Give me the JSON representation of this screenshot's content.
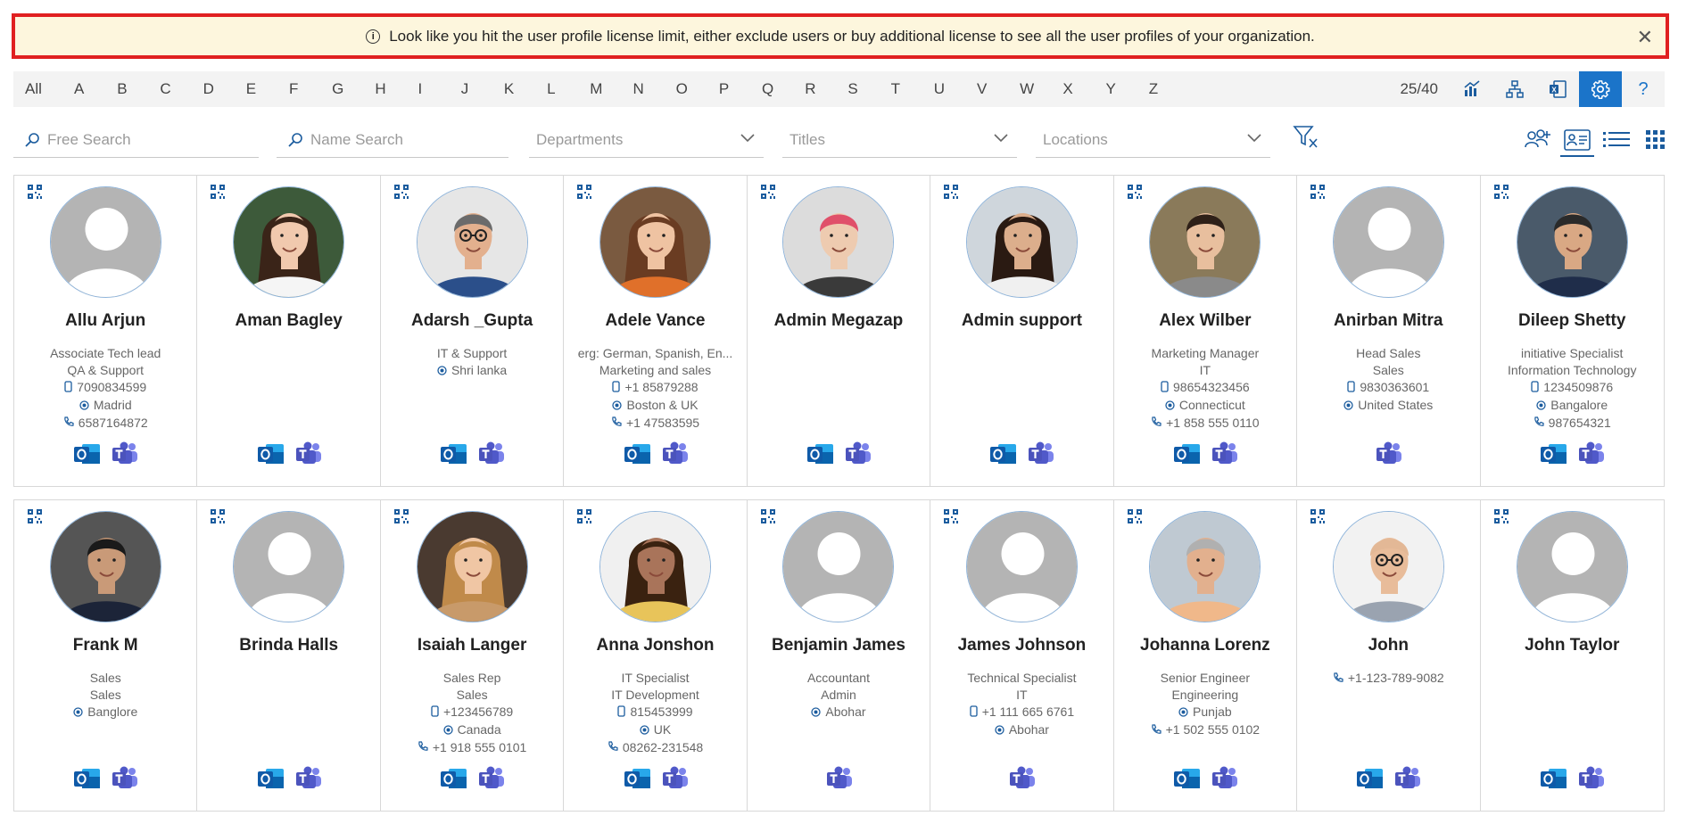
{
  "banner": {
    "message": "Look like you hit the user profile license limit, either exclude users or buy additional license to see all the user profiles of your organization.",
    "close_label": "✕"
  },
  "alphabet": [
    "All",
    "A",
    "B",
    "C",
    "D",
    "E",
    "F",
    "G",
    "H",
    "I",
    "J",
    "K",
    "L",
    "M",
    "N",
    "O",
    "P",
    "Q",
    "R",
    "S",
    "T",
    "U",
    "V",
    "W",
    "X",
    "Y",
    "Z"
  ],
  "toolbar": {
    "count": "25/40",
    "help_label": "?"
  },
  "filters": {
    "free_search": "Free Search",
    "name_search": "Name Search",
    "departments": "Departments",
    "titles": "Titles",
    "locations": "Locations"
  },
  "colors": {
    "accent": "#1b74c9",
    "banner_border": "#e02020",
    "banner_bg": "#fdf6dd"
  },
  "rows": [
    [
      {
        "name": "Allu Arjun",
        "photo": "placeholder",
        "lines": [
          {
            "t": "Associate Tech lead"
          },
          {
            "t": "QA & Support"
          },
          {
            "i": "mobile-icon",
            "t": "7090834599"
          },
          {
            "i": "location-icon",
            "t": "Madrid"
          },
          {
            "i": "phone-icon",
            "t": "6587164872"
          }
        ],
        "apps": [
          "outlook",
          "teams"
        ]
      },
      {
        "name": "Aman Bagley",
        "photo": "woman-dark-hair",
        "lines": [],
        "apps": [
          "outlook",
          "teams"
        ]
      },
      {
        "name": "Adarsh _Gupta",
        "photo": "man-glasses",
        "lines": [
          {
            "t": "IT & Support"
          },
          {
            "i": "location-icon",
            "t": "Shri lanka"
          }
        ],
        "apps": [
          "outlook",
          "teams"
        ]
      },
      {
        "name": "Adele Vance",
        "photo": "woman-curly",
        "lines": [
          {
            "t": "erg: German, Spanish, En..."
          },
          {
            "t": "Marketing and sales"
          },
          {
            "i": "mobile-icon",
            "t": "+1 85879288"
          },
          {
            "i": "location-icon",
            "t": "Boston & UK"
          },
          {
            "i": "phone-icon",
            "t": "+1 47583595"
          }
        ],
        "apps": [
          "outlook",
          "teams"
        ]
      },
      {
        "name": "Admin Megazap",
        "photo": "man-red-hair",
        "lines": [],
        "apps": [
          "outlook",
          "teams"
        ]
      },
      {
        "name": "Admin support",
        "photo": "woman-smile",
        "lines": [],
        "apps": [
          "outlook",
          "teams"
        ]
      },
      {
        "name": "Alex Wilber",
        "photo": "man-tie",
        "lines": [
          {
            "t": "Marketing Manager"
          },
          {
            "t": "IT"
          },
          {
            "i": "mobile-icon",
            "t": "98654323456"
          },
          {
            "i": "location-icon",
            "t": "Connecticut"
          },
          {
            "i": "phone-icon",
            "t": "+1 858 555 0110"
          }
        ],
        "apps": [
          "outlook",
          "teams"
        ]
      },
      {
        "name": "Anirban Mitra",
        "photo": "placeholder",
        "lines": [
          {
            "t": "Head Sales"
          },
          {
            "t": "Sales"
          },
          {
            "i": "mobile-icon",
            "t": "9830363601"
          },
          {
            "i": "location-icon",
            "t": "United States"
          }
        ],
        "apps": [
          "teams"
        ]
      },
      {
        "name": "Dileep Shetty",
        "photo": "man-suit",
        "lines": [
          {
            "t": "initiative Specialist"
          },
          {
            "t": "Information Technology"
          },
          {
            "i": "mobile-icon",
            "t": "1234509876"
          },
          {
            "i": "location-icon",
            "t": "Bangalore"
          },
          {
            "i": "phone-icon",
            "t": "987654321"
          }
        ],
        "apps": [
          "outlook",
          "teams"
        ]
      }
    ],
    [
      {
        "name": "Frank M",
        "photo": "man-dark-suit",
        "lines": [
          {
            "t": "Sales"
          },
          {
            "t": "Sales"
          },
          {
            "i": "location-icon",
            "t": "Banglore"
          }
        ],
        "apps": [
          "outlook",
          "teams"
        ]
      },
      {
        "name": "Brinda Halls",
        "photo": "placeholder",
        "lines": [],
        "apps": [
          "outlook",
          "teams"
        ]
      },
      {
        "name": "Isaiah Langer",
        "photo": "woman-blonde",
        "lines": [
          {
            "t": "Sales Rep"
          },
          {
            "t": "Sales"
          },
          {
            "i": "mobile-icon",
            "t": "+123456789"
          },
          {
            "i": "location-icon",
            "t": "Canada"
          },
          {
            "i": "phone-icon",
            "t": "+1 918 555 0101"
          }
        ],
        "apps": [
          "outlook",
          "teams"
        ]
      },
      {
        "name": "Anna Jonshon",
        "photo": "woman-headset",
        "lines": [
          {
            "t": "IT Specialist"
          },
          {
            "t": "IT Development"
          },
          {
            "i": "mobile-icon",
            "t": "815453999"
          },
          {
            "i": "location-icon",
            "t": "UK"
          },
          {
            "i": "phone-icon",
            "t": "08262-231548"
          }
        ],
        "apps": [
          "outlook",
          "teams"
        ]
      },
      {
        "name": "Benjamin James",
        "photo": "placeholder",
        "lines": [
          {
            "t": "Accountant"
          },
          {
            "t": "Admin"
          },
          {
            "i": "location-icon",
            "t": "Abohar"
          }
        ],
        "apps": [
          "teams"
        ]
      },
      {
        "name": "James Johnson",
        "photo": "placeholder",
        "lines": [
          {
            "t": "Technical Specialist"
          },
          {
            "t": "IT"
          },
          {
            "i": "mobile-icon",
            "t": "+1 111 665 6761"
          },
          {
            "i": "location-icon",
            "t": "Abohar"
          }
        ],
        "apps": [
          "teams"
        ]
      },
      {
        "name": "Johanna Lorenz",
        "photo": "man-grey-hair",
        "lines": [
          {
            "t": "Senior Engineer"
          },
          {
            "t": "Engineering"
          },
          {
            "i": "location-icon",
            "t": "Punjab"
          },
          {
            "i": "phone-icon",
            "t": "+1 502 555 0102"
          }
        ],
        "apps": [
          "outlook",
          "teams"
        ]
      },
      {
        "name": "John",
        "photo": "man-bald",
        "lines": [
          {
            "i": "phone-icon",
            "t": "+1-123-789-9082"
          }
        ],
        "apps": [
          "outlook",
          "teams"
        ]
      },
      {
        "name": "John Taylor",
        "photo": "placeholder",
        "lines": [],
        "apps": [
          "outlook",
          "teams"
        ]
      }
    ]
  ]
}
